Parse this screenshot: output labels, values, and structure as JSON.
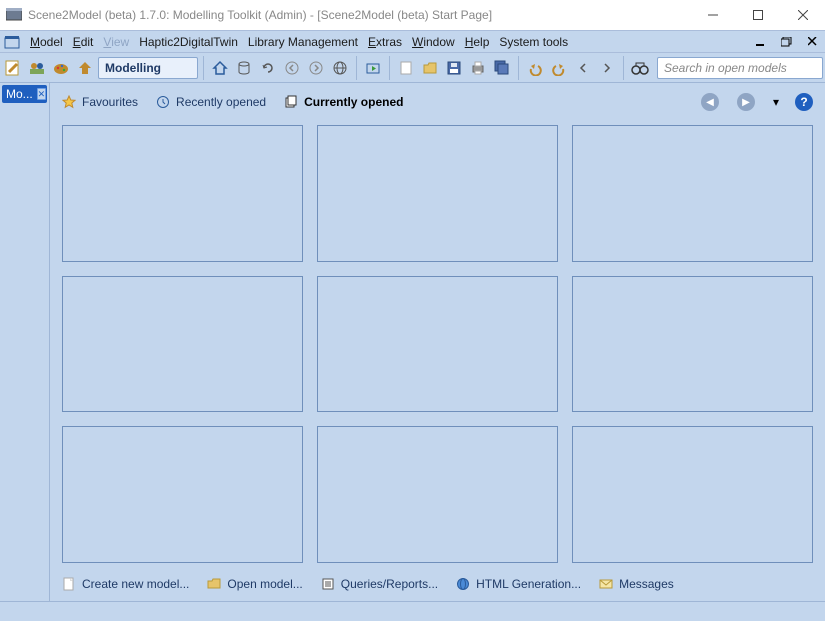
{
  "window": {
    "title": "Scene2Model (beta) 1.7.0: Modelling Toolkit (Admin) - [Scene2Model (beta) Start Page]"
  },
  "menubar": {
    "items": [
      {
        "label": "Model",
        "ul": "M",
        "enabled": true
      },
      {
        "label": "Edit",
        "ul": "E",
        "enabled": true
      },
      {
        "label": "View",
        "ul": "V",
        "enabled": false
      },
      {
        "label": "Haptic2DigitalTwin",
        "ul": "",
        "enabled": true
      },
      {
        "label": "Library Management",
        "ul": "",
        "enabled": true
      },
      {
        "label": "Extras",
        "ul": "E",
        "enabled": true
      },
      {
        "label": "Window",
        "ul": "W",
        "enabled": true
      },
      {
        "label": "Help",
        "ul": "H",
        "enabled": true
      },
      {
        "label": "System tools",
        "ul": "",
        "enabled": true
      }
    ]
  },
  "toolbar": {
    "mode_label": "Modelling",
    "search_placeholder": "Search in open models"
  },
  "side_panel": {
    "tab_label": "Mo..."
  },
  "start_page": {
    "tabs": {
      "favourites": "Favourites",
      "recently_opened": "Recently opened",
      "currently_opened": "Currently opened"
    },
    "bottom_links": {
      "create": "Create new model...",
      "open": "Open model...",
      "queries": "Queries/Reports...",
      "html": "HTML Generation...",
      "messages": "Messages"
    }
  }
}
